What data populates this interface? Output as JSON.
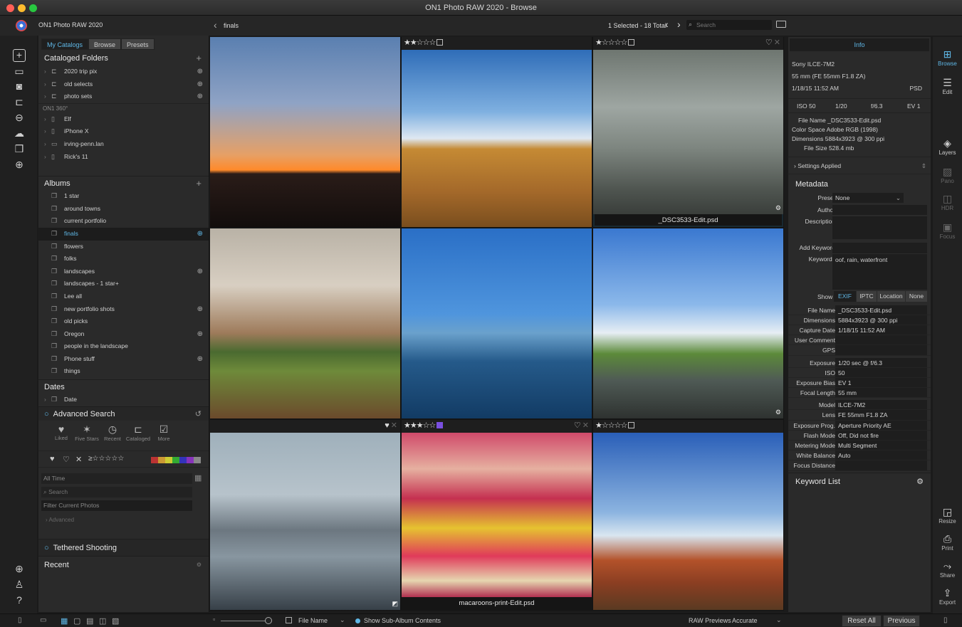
{
  "window": {
    "title": "ON1 Photo RAW 2020 - Browse"
  },
  "app": {
    "name": "ON1 Photo RAW 2020"
  },
  "nav": {
    "back_label": "finals",
    "selection_status": "1 Selected - 18 Total",
    "search_placeholder": "Search"
  },
  "left_tabs": [
    {
      "label": "My Catalogs",
      "active": true
    },
    {
      "label": "Browse",
      "active": false
    },
    {
      "label": "Presets",
      "active": false
    }
  ],
  "cataloged_folders": {
    "title": "Cataloged Folders",
    "items": [
      "2020 trip pix",
      "old selects",
      "photo sets"
    ]
  },
  "on1_360": {
    "title": "ON1 360°",
    "items": [
      "Elf",
      "iPhone X",
      "irving-penn.lan",
      "Rick's 11"
    ]
  },
  "albums": {
    "title": "Albums",
    "items": [
      {
        "label": "1 star",
        "target": false,
        "selected": false
      },
      {
        "label": "around towns",
        "target": false,
        "selected": false
      },
      {
        "label": "current portfolio",
        "target": false,
        "selected": false
      },
      {
        "label": "finals",
        "target": true,
        "selected": true
      },
      {
        "label": "flowers",
        "target": false,
        "selected": false
      },
      {
        "label": "folks",
        "target": false,
        "selected": false
      },
      {
        "label": "landscapes",
        "target": true,
        "selected": false
      },
      {
        "label": "landscapes - 1 star+",
        "target": false,
        "selected": false
      },
      {
        "label": "Lee all",
        "target": false,
        "selected": false
      },
      {
        "label": "new portfolio shots",
        "target": true,
        "selected": false
      },
      {
        "label": "old picks",
        "target": false,
        "selected": false
      },
      {
        "label": "Oregon",
        "target": true,
        "selected": false
      },
      {
        "label": "people in the landscape",
        "target": false,
        "selected": false
      },
      {
        "label": "Phone stuff",
        "target": true,
        "selected": false
      },
      {
        "label": "things",
        "target": false,
        "selected": false
      }
    ]
  },
  "dates": {
    "title": "Dates",
    "item": "Date"
  },
  "advanced_search": {
    "title": "Advanced Search",
    "presets": [
      {
        "label": "Liked",
        "icon": "heart-icon"
      },
      {
        "label": "Five Stars",
        "icon": "stars-icon"
      },
      {
        "label": "Recent",
        "icon": "clock-icon"
      },
      {
        "label": "Cataloged",
        "icon": "folder-icon"
      },
      {
        "label": "More",
        "icon": "chevron-box-icon"
      }
    ],
    "time_field": "All Time",
    "search_placeholder": "Search",
    "filter_placeholder": "Filter Current Photos",
    "advanced_label": "Advanced"
  },
  "tethered": {
    "title": "Tethered Shooting"
  },
  "recent": {
    "title": "Recent"
  },
  "thumbnails": [
    {
      "stars": 0,
      "caption": "",
      "hearts": false,
      "gear": false,
      "top_bar": false
    },
    {
      "stars": 2,
      "caption": "",
      "hearts": false,
      "gear": false,
      "top_bar": true
    },
    {
      "stars": 1,
      "caption": "_DSC3533-Edit.psd",
      "hearts": true,
      "gear": true,
      "top_bar": true
    },
    {
      "stars": 0,
      "caption": "",
      "hearts": false,
      "gear": false,
      "top_bar": false
    },
    {
      "stars": 0,
      "caption": "",
      "hearts": false,
      "gear": false,
      "top_bar": false
    },
    {
      "stars": 0,
      "caption": "",
      "hearts": false,
      "gear": true,
      "top_bar": false
    },
    {
      "stars": 0,
      "caption": "",
      "hearts": true,
      "gear": false,
      "top_bar": true
    },
    {
      "stars": 3,
      "caption": "macaroons-print-Edit.psd",
      "hearts": true,
      "gear": false,
      "top_bar": true
    },
    {
      "stars": 1,
      "caption": "",
      "hearts": false,
      "gear": false,
      "top_bar": true
    }
  ],
  "info": {
    "tab": "Info",
    "camera": "Sony ILCE-7M2",
    "lens": "55 mm (FE 55mm F1.8 ZA)",
    "datetime": "1/18/15 11:52 AM",
    "format": "PSD",
    "iso": "ISO 50",
    "shutter": "1/20",
    "aperture": "f/6.3",
    "ev": "EV 1",
    "file_name_line": "File Name _DSC3533-Edit.psd",
    "color_space_line": "Color Space Adobe RGB (1998)",
    "dimensions_line": "Dimensions 5884x3923 @ 300 ppi",
    "file_size_line": "File Size 528.4 mb",
    "settings_applied": "Settings Applied"
  },
  "metadata": {
    "title": "Metadata",
    "preset_label": "Preset",
    "preset_value": "None",
    "author_label": "Author",
    "description_label": "Description",
    "add_keyword_label": "Add Keyword",
    "keywords_label": "Keywords",
    "keywords_value": "oof, rain, waterfront",
    "show_label": "Show",
    "show_tabs": [
      "EXIF",
      "IPTC",
      "Location",
      "None"
    ],
    "rows": [
      {
        "label": "File Name",
        "value": "_DSC3533-Edit.psd"
      },
      {
        "label": "Dimensions",
        "value": "5884x3923 @ 300 ppi"
      },
      {
        "label": "Capture Date",
        "value": "1/18/15 11:52 AM"
      },
      {
        "label": "User Comment",
        "value": ""
      },
      {
        "label": "GPS",
        "value": ""
      },
      {
        "label": "Exposure",
        "value": "1/20 sec @ f/6.3"
      },
      {
        "label": "ISO",
        "value": "50"
      },
      {
        "label": "Exposure Bias",
        "value": "EV 1"
      },
      {
        "label": "Focal Length",
        "value": "55 mm"
      },
      {
        "label": "Model",
        "value": "ILCE-7M2"
      },
      {
        "label": "Lens",
        "value": "FE 55mm F1.8 ZA"
      },
      {
        "label": "Exposure Prog.",
        "value": "Aperture Priority AE"
      },
      {
        "label": "Flash Mode",
        "value": "Off, Did not fire"
      },
      {
        "label": "Metering Mode",
        "value": "Multi Segment"
      },
      {
        "label": "White Balance",
        "value": "Auto"
      },
      {
        "label": "Focus Distance",
        "value": ""
      }
    ],
    "keyword_list": "Keyword List"
  },
  "right_rail": {
    "top": [
      {
        "label": "Browse",
        "icon": "browse-icon",
        "active": true
      },
      {
        "label": "Edit",
        "icon": "sliders-icon",
        "active": false
      },
      {
        "label": "Layers",
        "icon": "layers-icon",
        "active": false
      },
      {
        "label": "Pano",
        "icon": "pano-icon",
        "active": false
      },
      {
        "label": "HDR",
        "icon": "hdr-icon",
        "active": false
      },
      {
        "label": "Focus",
        "icon": "focus-icon",
        "active": false
      }
    ],
    "bottom": [
      {
        "label": "Resize",
        "icon": "resize-icon"
      },
      {
        "label": "Print",
        "icon": "print-icon"
      },
      {
        "label": "Share",
        "icon": "share-icon"
      },
      {
        "label": "Export",
        "icon": "export-icon"
      }
    ]
  },
  "bottom": {
    "sort_label": "File Name",
    "sub_album_label": "Show Sub-Album Contents",
    "raw_previews_label": "RAW Previews",
    "raw_previews_value": "Accurate",
    "reset_all": "Reset All",
    "previous": "Previous"
  },
  "colors": {
    "accent": "#5fb7e6",
    "selection_border": "#3aa3d6"
  }
}
